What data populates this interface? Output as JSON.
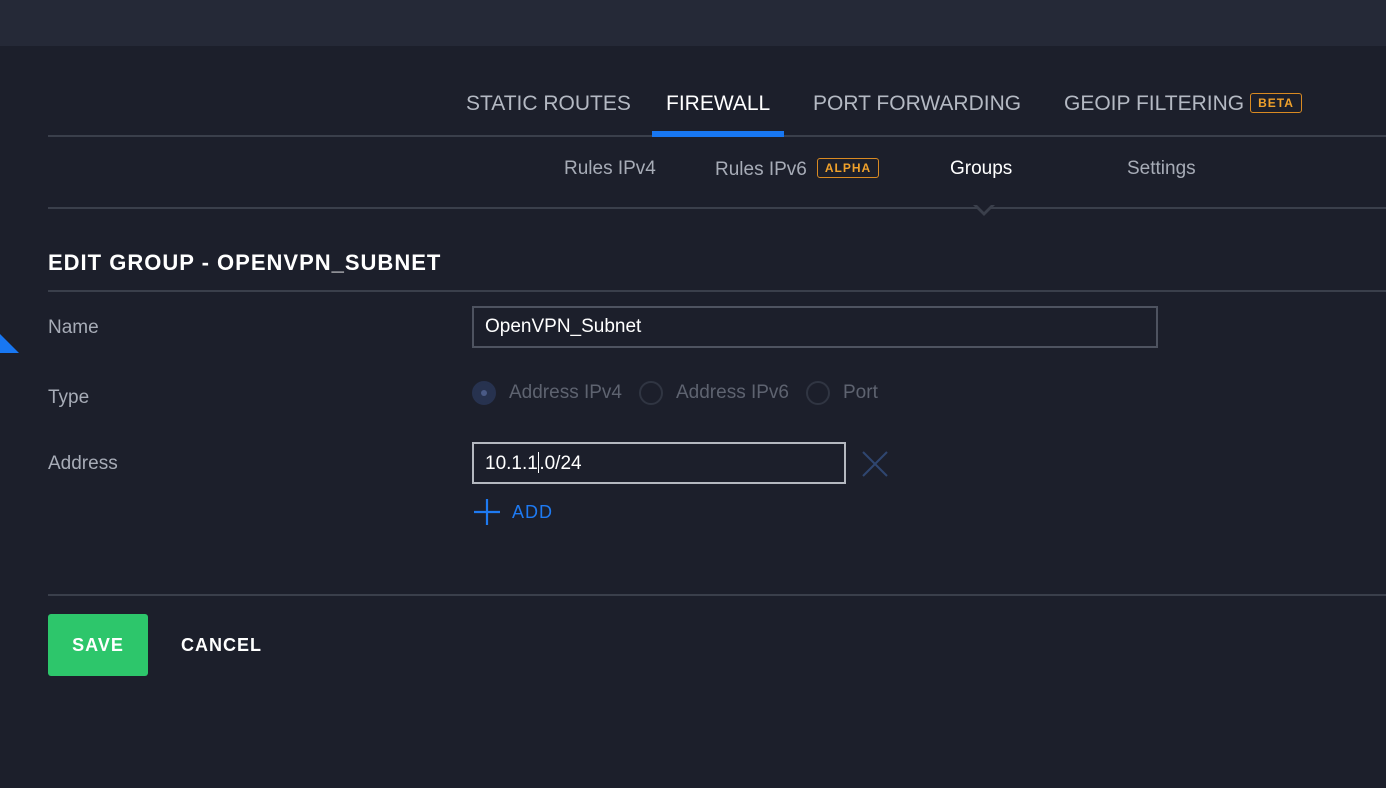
{
  "tabs": [
    {
      "label": "STATIC ROUTES"
    },
    {
      "label": "FIREWALL",
      "active": true
    },
    {
      "label": "PORT FORWARDING"
    },
    {
      "label": "GEOIP FILTERING",
      "badge": "BETA"
    }
  ],
  "subtabs": [
    {
      "label": "Rules IPv4"
    },
    {
      "label": "Rules IPv6",
      "badge": "ALPHA"
    },
    {
      "label": "Groups",
      "active": true
    },
    {
      "label": "Settings"
    }
  ],
  "form": {
    "title": "EDIT GROUP - OPENVPN_SUBNET",
    "name_label": "Name",
    "name_value": "OpenVPN_Subnet",
    "type_label": "Type",
    "type_options": [
      "Address IPv4",
      "Address IPv6",
      "Port"
    ],
    "type_selected": "Address IPv4",
    "address_label": "Address",
    "address_value_before_cursor": "10.1.1",
    "address_value_after_cursor": ".0/24",
    "add_label": "ADD"
  },
  "actions": {
    "save_label": "SAVE",
    "cancel_label": "CANCEL"
  },
  "colors": {
    "background": "#1c1f2b",
    "accent": "#1877f2",
    "save": "#2dc66b",
    "badge": "#f0a12b"
  },
  "icons": {
    "remove": "close-icon",
    "add": "plus-icon"
  }
}
